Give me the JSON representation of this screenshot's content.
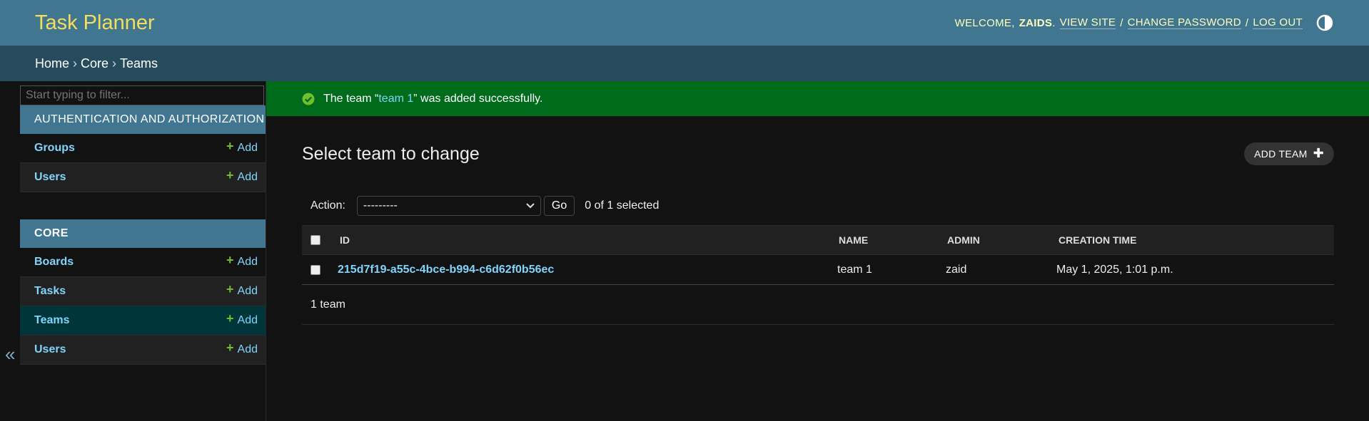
{
  "header": {
    "site_title": "Task Planner",
    "welcome": "WELCOME,",
    "username": "ZAIDS",
    "view_site": "VIEW SITE",
    "change_password": "CHANGE PASSWORD",
    "log_out": "LOG OUT",
    "separator": "/"
  },
  "breadcrumbs": {
    "home": "Home",
    "app": "Core",
    "current": "Teams",
    "sep": "›"
  },
  "sidebar": {
    "filter_placeholder": "Start typing to filter...",
    "toggle": "«",
    "modules": [
      {
        "caption": "AUTHENTICATION AND AUTHORIZATION",
        "items": [
          {
            "label": "Groups",
            "add": "Add"
          },
          {
            "label": "Users",
            "add": "Add"
          }
        ]
      },
      {
        "caption": "CORE",
        "items": [
          {
            "label": "Boards",
            "add": "Add"
          },
          {
            "label": "Tasks",
            "add": "Add"
          },
          {
            "label": "Teams",
            "add": "Add"
          },
          {
            "label": "Users",
            "add": "Add"
          }
        ]
      }
    ]
  },
  "message": {
    "before": "The team “",
    "link": "team 1",
    "after": "” was added successfully."
  },
  "page": {
    "title": "Select team to change",
    "add_button": "ADD TEAM",
    "action_label": "Action:",
    "action_selected": "---------",
    "go": "Go",
    "selection_count": "0 of 1 selected"
  },
  "table": {
    "columns": [
      "ID",
      "NAME",
      "ADMIN",
      "CREATION TIME"
    ],
    "rows": [
      {
        "id": "215d7f19-a55c-4bce-b994-c6d62f0b56ec",
        "name": "team 1",
        "admin": "zaid",
        "creation_time": "May 1, 2025, 1:01 p.m."
      }
    ],
    "paginator": "1 team"
  },
  "colors": {
    "header": "#417690",
    "breadcrumbs": "#264b5d",
    "success": "#006b1b",
    "link": "#81d4fa",
    "add_plus": "#70bf2b",
    "brand": "#f5dd5d"
  }
}
